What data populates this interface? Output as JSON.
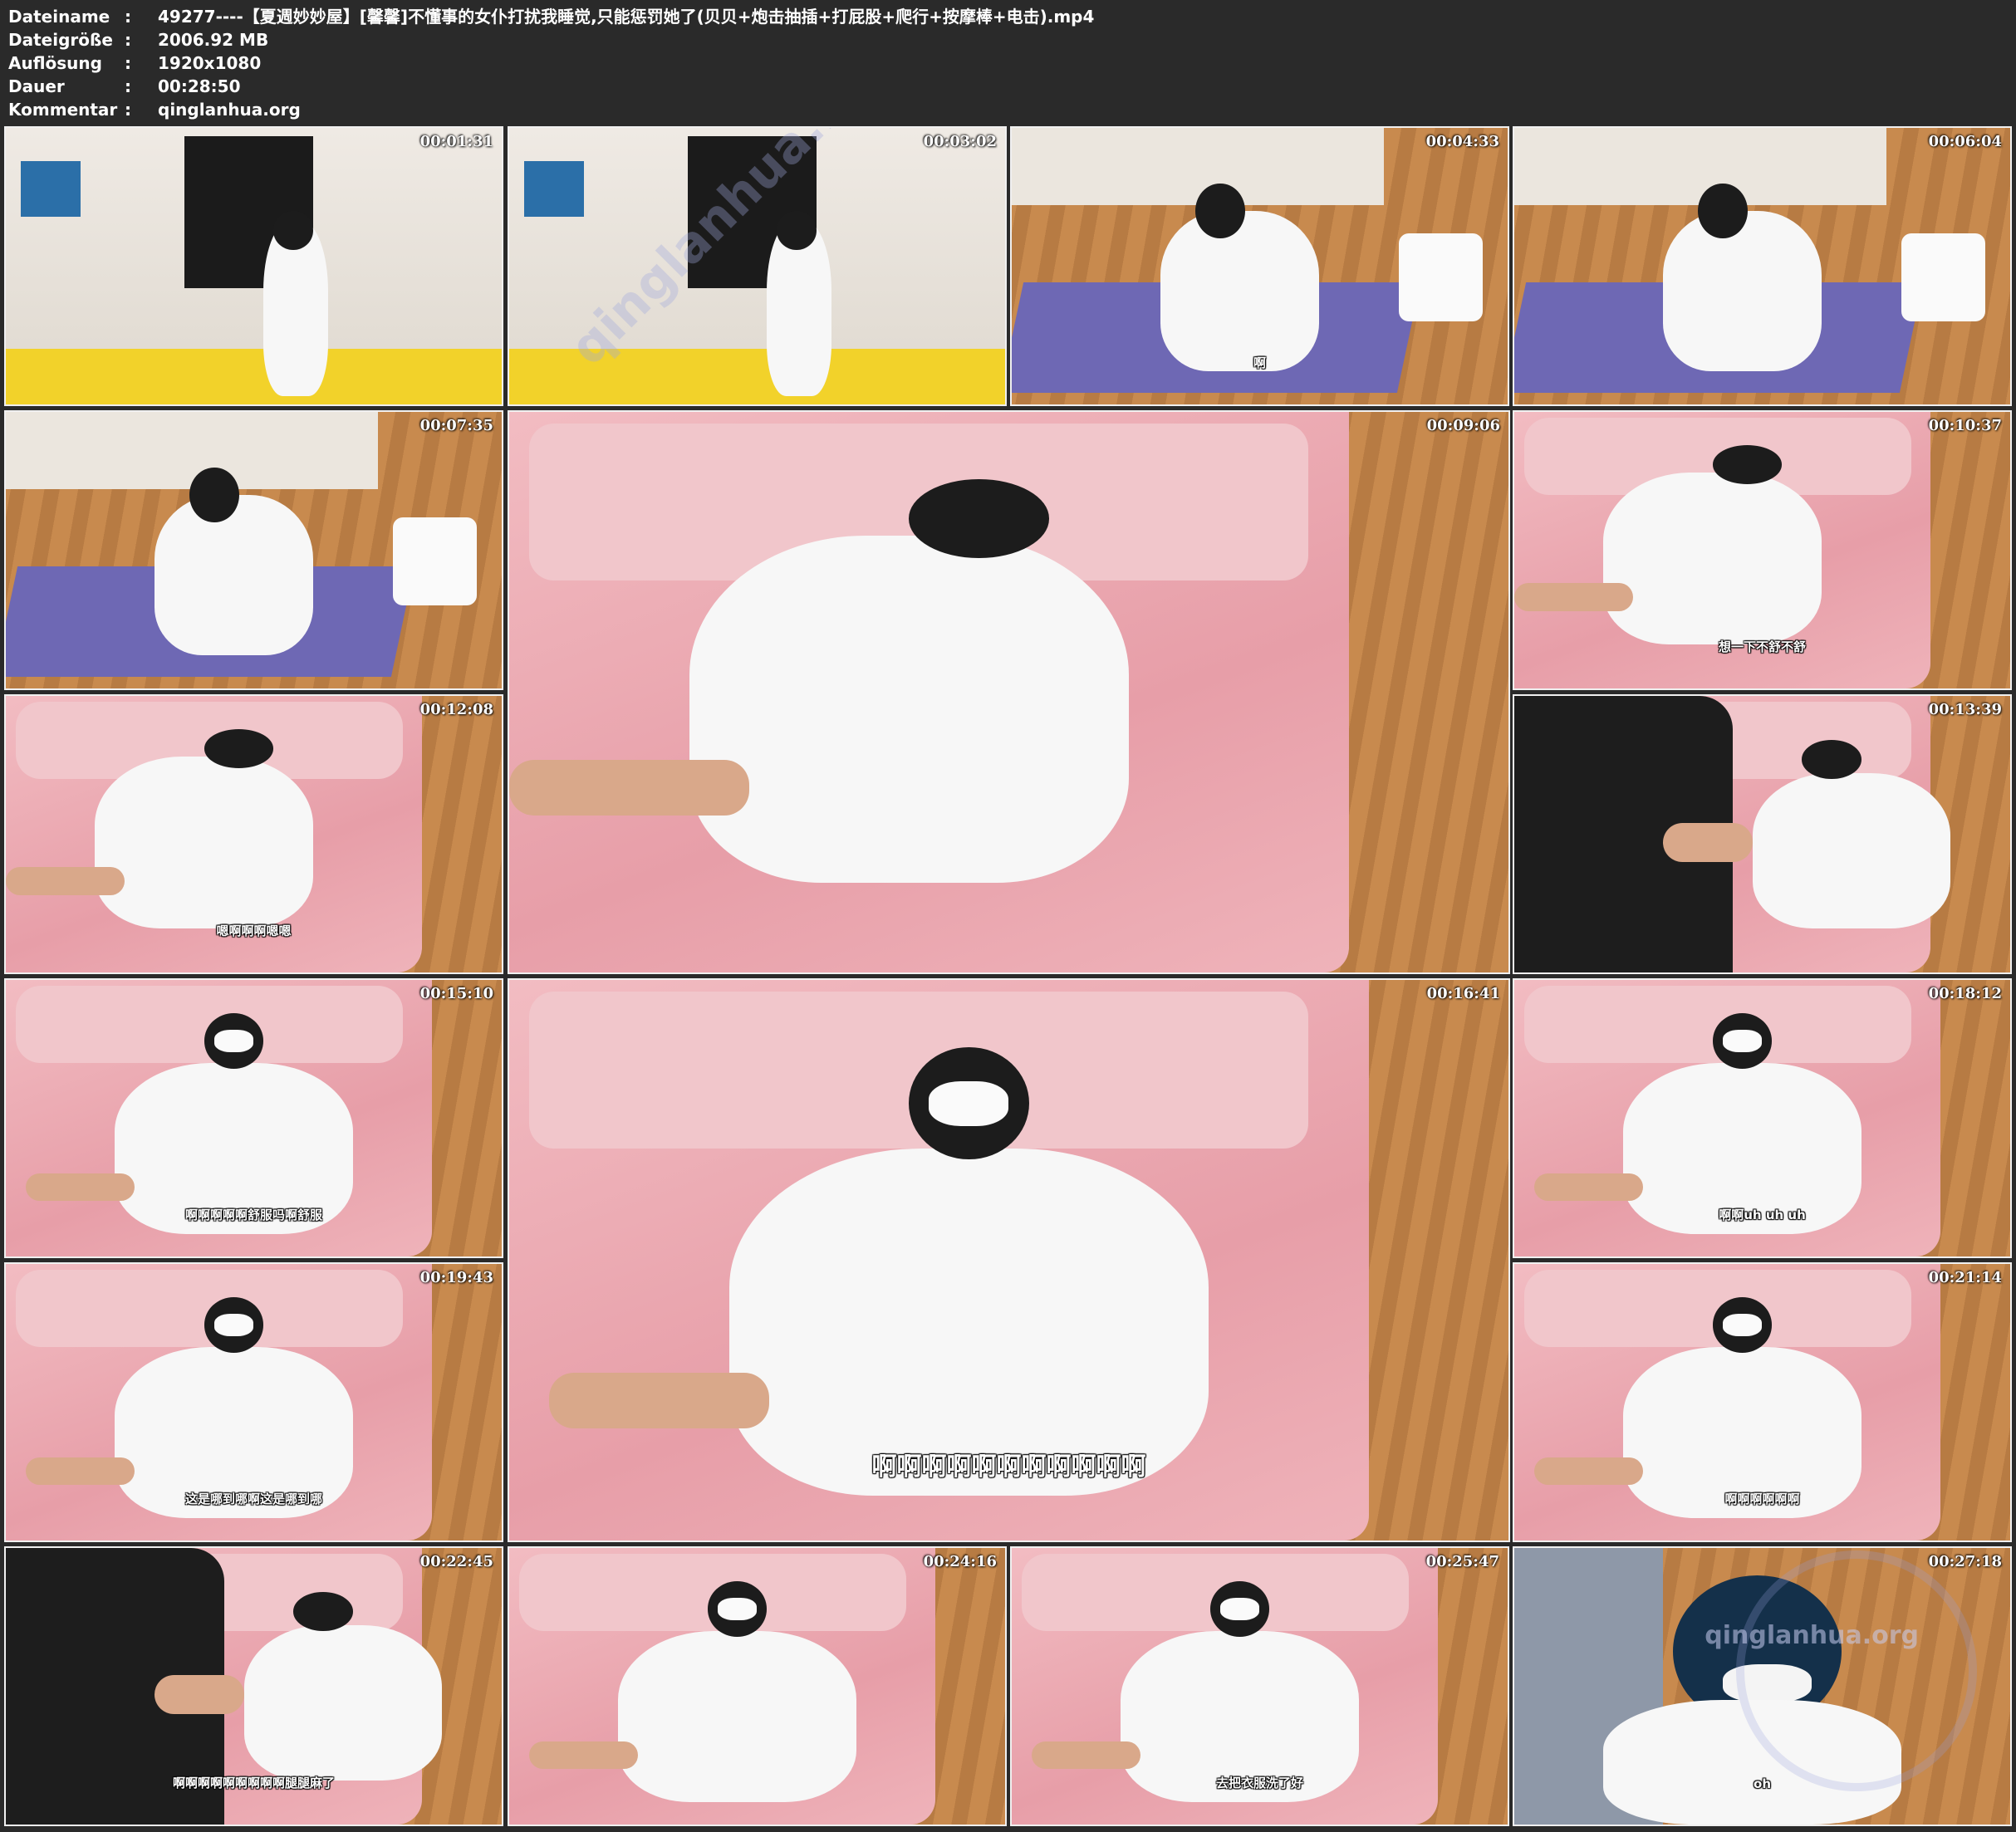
{
  "header": {
    "rows": [
      {
        "key": "Dateiname",
        "sep": ":",
        "value": "49277----【夏週妙妙屋】[馨馨]不懂事的女仆打扰我睡觉,只能惩罚她了(贝贝+炮击抽插+打屁股+爬行+按摩棒+电击).mp4"
      },
      {
        "key": "Dateigröße",
        "sep": ":",
        "value": "2006.92 MB"
      },
      {
        "key": "Auflösung",
        "sep": ":",
        "value": "1920x1080"
      },
      {
        "key": "Dauer",
        "sep": ":",
        "value": "00:28:50"
      },
      {
        "key": "Kommentar",
        "sep": ":",
        "value": "qinglanhua.org"
      }
    ]
  },
  "thumbnails": [
    {
      "timestamp": "00:01:31",
      "subtitle": ""
    },
    {
      "timestamp": "00:03:02",
      "subtitle": ""
    },
    {
      "timestamp": "00:04:33",
      "subtitle": "啊"
    },
    {
      "timestamp": "00:06:04",
      "subtitle": ""
    },
    {
      "timestamp": "00:07:35",
      "subtitle": ""
    },
    {
      "timestamp": "00:09:06",
      "subtitle": ""
    },
    {
      "timestamp": "00:10:37",
      "subtitle": "想一下不舒不舒"
    },
    {
      "timestamp": "00:12:08",
      "subtitle": "嗯啊啊啊嗯嗯"
    },
    {
      "timestamp": "00:13:39",
      "subtitle": ""
    },
    {
      "timestamp": "00:15:10",
      "subtitle": "啊啊啊啊啊舒服吗啊舒服"
    },
    {
      "timestamp": "00:16:41",
      "subtitle": "啊啊啊啊啊啊啊啊啊啊啊"
    },
    {
      "timestamp": "00:18:12",
      "subtitle": "啊啊uh uh uh"
    },
    {
      "timestamp": "00:19:43",
      "subtitle": "这是哪到哪啊这是哪到哪"
    },
    {
      "timestamp": "00:21:14",
      "subtitle": "啊啊啊啊啊啊"
    },
    {
      "timestamp": "00:22:45",
      "subtitle": "啊啊啊啊啊啊啊啊啊腿腿麻了"
    },
    {
      "timestamp": "00:24:16",
      "subtitle": ""
    },
    {
      "timestamp": "00:25:47",
      "subtitle": "去把衣服洗了好"
    },
    {
      "timestamp": "00:27:18",
      "subtitle": "oh"
    }
  ],
  "watermarks": {
    "diagonal": "qinglanhua.net",
    "corner": "qinglanhua.org"
  },
  "colors": {
    "background": "#2a2a2a",
    "border": "#f0f0f0",
    "bed_pink": "#eaa6ae",
    "floor_wood": "#c08346",
    "mat_purple": "#6e68b4"
  }
}
